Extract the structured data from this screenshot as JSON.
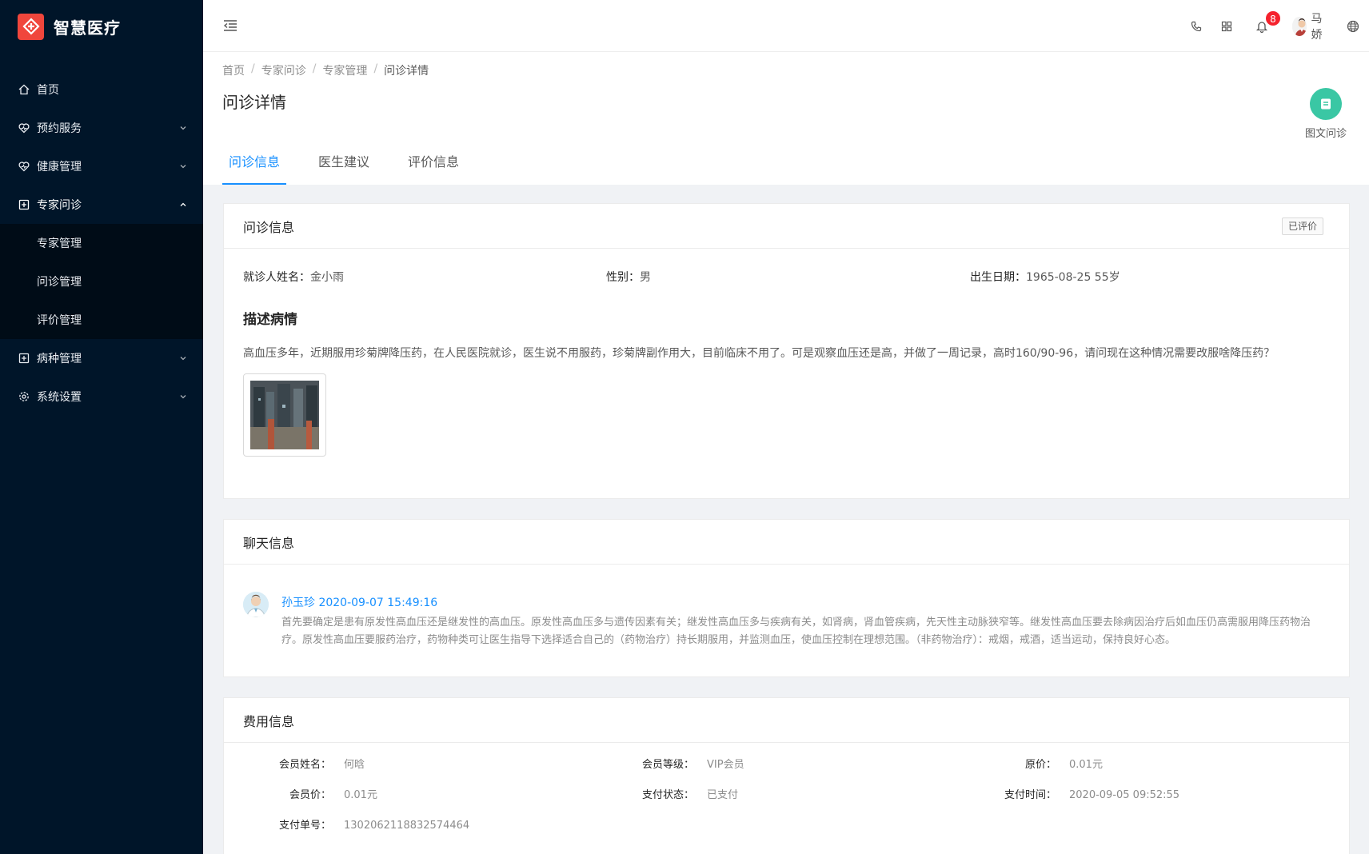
{
  "brand": {
    "name": "智慧医疗"
  },
  "sidebar": {
    "items": [
      {
        "label": "首页",
        "icon": "home-icon"
      },
      {
        "label": "预约服务",
        "icon": "heart-icon"
      },
      {
        "label": "健康管理",
        "icon": "heart-icon"
      },
      {
        "label": "专家问诊",
        "icon": "medical-plus-icon"
      },
      {
        "label": "病种管理",
        "icon": "medical-plus-icon"
      },
      {
        "label": "系统设置",
        "icon": "settings-icon"
      }
    ],
    "submenu": [
      "专家管理",
      "问诊管理",
      "评价管理"
    ]
  },
  "header": {
    "notification_count": "8",
    "user_name": "马娇"
  },
  "breadcrumb": [
    "首页",
    "专家问诊",
    "专家管理",
    "问诊详情"
  ],
  "page": {
    "title": "问诊详情",
    "tool_label": "图文问诊",
    "tabs": [
      "问诊信息",
      "医生建议",
      "评价信息"
    ]
  },
  "consult": {
    "title": "问诊信息",
    "status_tag": "已评价",
    "patient_label": "就诊人姓名：",
    "patient_value": "金小雨",
    "gender_label": "性别：",
    "gender_value": "男",
    "birth_label": "出生日期：",
    "birth_value": "1965-08-25 55岁",
    "desc_title": "描述病情",
    "desc_text": "高血压多年，近期服用珍菊牌降压药，在人民医院就诊，医生说不用服药，珍菊牌副作用大，目前临床不用了。可是观察血压还是高，并做了一周记录，高时160/90-96，请问现在这种情况需要改服啥降压药？"
  },
  "chat": {
    "title": "聊天信息",
    "messages": [
      {
        "author_time": "孙玉珍 2020-09-07 15:49:16",
        "text": "首先要确定是患有原发性高血压还是继发性的高血压。原发性高血压多与遗传因素有关；继发性高血压多与疾病有关，如肾病，肾血管疾病，先天性主动脉狭窄等。继发性高血压要去除病因治疗后如血压仍高需服用降压药物治疗。原发性高血压要服药治疗，药物种类可让医生指导下选择适合自己的（药物治疗）持长期服用，并监测血压，使血压控制在理想范围。（非药物治疗）：戒烟，戒酒，适当运动，保持良好心态。"
      }
    ]
  },
  "fee": {
    "title": "费用信息",
    "fields": [
      {
        "label": "会员姓名：",
        "value": "何晗"
      },
      {
        "label": "会员等级：",
        "value": "VIP会员"
      },
      {
        "label": "原价：",
        "value": "0.01元"
      },
      {
        "label": "会员价：",
        "value": "0.01元"
      },
      {
        "label": "支付状态：",
        "value": "已支付"
      },
      {
        "label": "支付时间：",
        "value": "2020-09-05 09:52:55"
      },
      {
        "label": "支付单号：",
        "value": "1302062118832574464"
      }
    ]
  },
  "colors": {
    "sidebar_bg": "#001529",
    "submenu_bg": "#000c17",
    "accent": "#1890ff",
    "brand_logo": "#f0463c",
    "tool_button": "#3ac7a4",
    "badge": "#f5222d"
  }
}
